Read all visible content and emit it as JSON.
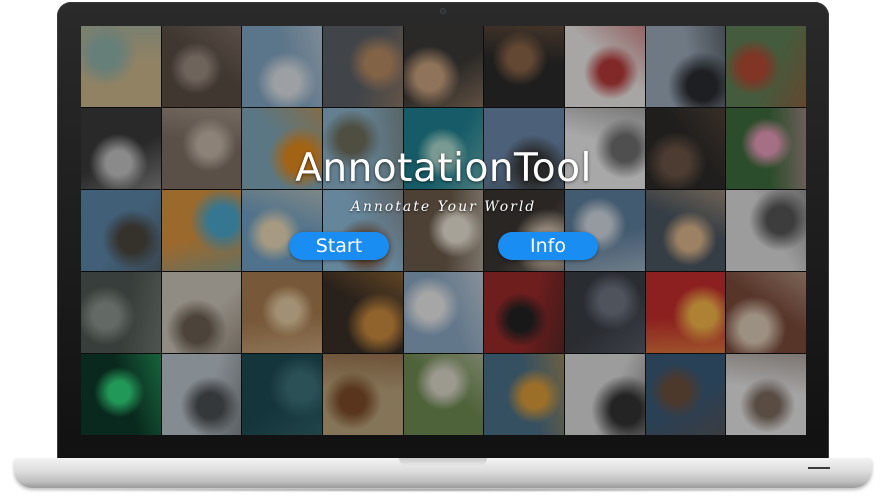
{
  "app": {
    "title": "AnnotationTool",
    "tagline": "Annotate Your World"
  },
  "buttons": {
    "start_label": "Start",
    "info_label": "Info"
  },
  "colors": {
    "accent": "#1a8df2",
    "bezel": "#141414",
    "chassis": "#d8d8d8"
  },
  "photo_grid": {
    "columns": 9,
    "rows": 5,
    "tiles": [
      {
        "subject": "vintage-car-photo",
        "bg": "#c9b48a",
        "fg": "#8fb0a8"
      },
      {
        "subject": "person-legs-photo",
        "bg": "#5a4d44",
        "fg": "#9a8b80"
      },
      {
        "subject": "surfers-beach-photo",
        "bg": "#7fa2bf",
        "fg": "#d8dde2"
      },
      {
        "subject": "city-aerial-photo",
        "bg": "#5a5f66",
        "fg": "#b58a62"
      },
      {
        "subject": "child-portrait-photo",
        "bg": "#3b3936",
        "fg": "#c7a07d"
      },
      {
        "subject": "architecture-photo",
        "bg": "#2a2a2a",
        "fg": "#8a6448"
      },
      {
        "subject": "berry-pie-photo",
        "bg": "#e9e6e4",
        "fg": "#b33a3a"
      },
      {
        "subject": "silhouettes-cafe-photo",
        "bg": "#9aa8b8",
        "fg": "#2a2c30"
      },
      {
        "subject": "pagoda-landscape-photo",
        "bg": "#5f7f55",
        "fg": "#b24a34"
      },
      {
        "subject": "guitarist-photo",
        "bg": "#3a3a3a",
        "fg": "#bfbfbf"
      },
      {
        "subject": "bridge-walkway-photo",
        "bg": "#7d6f64",
        "fg": "#c2b5a6"
      },
      {
        "subject": "orange-car-photo",
        "bg": "#7fa6b7",
        "fg": "#e28a1d"
      },
      {
        "subject": "coastal-landscape-photo",
        "bg": "#8ab1c8",
        "fg": "#6c6c5a"
      },
      {
        "subject": "turquoise-island-photo",
        "bg": "#1f7f8f",
        "fg": "#a7d4c9"
      },
      {
        "subject": "london-skyline-photo",
        "bg": "#6a86a8",
        "fg": "#3a3a3a"
      },
      {
        "subject": "statue-liberty-photo",
        "bg": "#e9e9e9",
        "fg": "#6e6e6e"
      },
      {
        "subject": "couple-portrait-photo",
        "bg": "#2c2a28",
        "fg": "#6b5445"
      },
      {
        "subject": "tulips-photo",
        "bg": "#3e6b3c",
        "fg": "#e59ab8"
      },
      {
        "subject": "eagle-photo",
        "bg": "#5a84a6",
        "fg": "#4a443c"
      },
      {
        "subject": "kid-goggles-photo",
        "bg": "#d8923f",
        "fg": "#4aa5c9"
      },
      {
        "subject": "beach-umbrella-photo",
        "bg": "#6f9fc2",
        "fg": "#e7d7b5"
      },
      {
        "subject": "meditation-photo",
        "bg": "#8cb9d6",
        "fg": "#7a5a44"
      },
      {
        "subject": "notebook-desk-photo",
        "bg": "#6b5a4a",
        "fg": "#e8e1d3"
      },
      {
        "subject": "coffee-cup-photo",
        "bg": "#3b3531",
        "fg": "#c9b9a6"
      },
      {
        "subject": "pier-sea-photo",
        "bg": "#5e7f9c",
        "fg": "#cfd6de"
      },
      {
        "subject": "rainy-street-photo",
        "bg": "#4a5560",
        "fg": "#d9b48a"
      },
      {
        "subject": "glasses-table-photo",
        "bg": "#d9d9d9",
        "fg": "#555555"
      },
      {
        "subject": "forest-mist-photo",
        "bg": "#4e5752",
        "fg": "#8a938c"
      },
      {
        "subject": "cliff-sitting-photo",
        "bg": "#c9c2b6",
        "fg": "#6a5f52"
      },
      {
        "subject": "rock-shoreline-photo",
        "bg": "#a67a4e",
        "fg": "#e0c8a0"
      },
      {
        "subject": "pie-candle-photo",
        "bg": "#3a2f26",
        "fg": "#c98a3e"
      },
      {
        "subject": "mountain-hiker-photo",
        "bg": "#8aa6c1",
        "fg": "#e7e7e7"
      },
      {
        "subject": "camera-red-photo",
        "bg": "#9a2a2a",
        "fg": "#222222"
      },
      {
        "subject": "dark-mountain-photo",
        "bg": "#3a3d45",
        "fg": "#6d7480"
      },
      {
        "subject": "red-flower-photo",
        "bg": "#c22c2c",
        "fg": "#f2b34a"
      },
      {
        "subject": "street-shop-photo",
        "bg": "#7a4a3a",
        "fg": "#d9c8b4"
      },
      {
        "subject": "aurora-photo",
        "bg": "#0f3a2a",
        "fg": "#2fd27a"
      },
      {
        "subject": "modern-building-photo",
        "bg": "#b9c2c9",
        "fg": "#4a4e52"
      },
      {
        "subject": "ocean-swimmer-photo",
        "bg": "#1e4a54",
        "fg": "#3c6f78"
      },
      {
        "subject": "highland-cow-photo",
        "bg": "#b9a27a",
        "fg": "#7a4a28"
      },
      {
        "subject": "cat-fence-photo",
        "bg": "#6e8a52",
        "fg": "#d9d4c7"
      },
      {
        "subject": "airplane-sky-photo",
        "bg": "#4a6f86",
        "fg": "#d99a3a"
      },
      {
        "subject": "sprinter-photo",
        "bg": "#d9d9d9",
        "fg": "#333333"
      },
      {
        "subject": "man-camera-photo",
        "bg": "#3a5a78",
        "fg": "#6a4f3e"
      },
      {
        "subject": "bride-bouquet-photo",
        "bg": "#e3e3e3",
        "fg": "#7a6a5e"
      }
    ]
  }
}
